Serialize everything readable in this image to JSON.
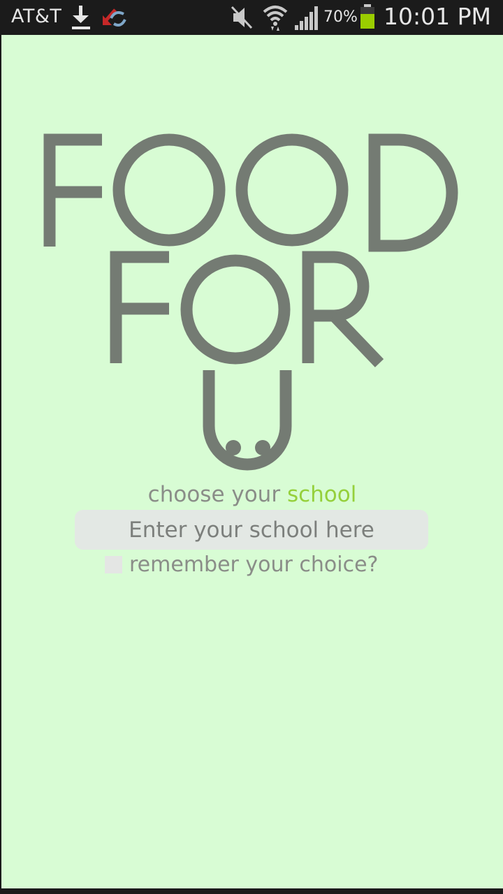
{
  "status_bar": {
    "carrier": "AT&T",
    "battery": "70%",
    "time": "10:01 PM",
    "icons": [
      "download-icon",
      "sync-error-icon",
      "mute-icon",
      "wifi-icon",
      "signal-icon",
      "battery-icon"
    ]
  },
  "logo": {
    "line1": "FOOD",
    "line2": "FOR",
    "line3": "U"
  },
  "tagline": {
    "prefix": "choose your ",
    "accent": "school"
  },
  "school_input": {
    "placeholder": "Enter your school here",
    "value": ""
  },
  "remember": {
    "label": "remember your choice?",
    "checked": false
  },
  "colors": {
    "background": "#d8fcd4",
    "logo": "#747b73",
    "accent": "#95d03b",
    "text": "#8a8d88",
    "battery": "#9acd00"
  }
}
